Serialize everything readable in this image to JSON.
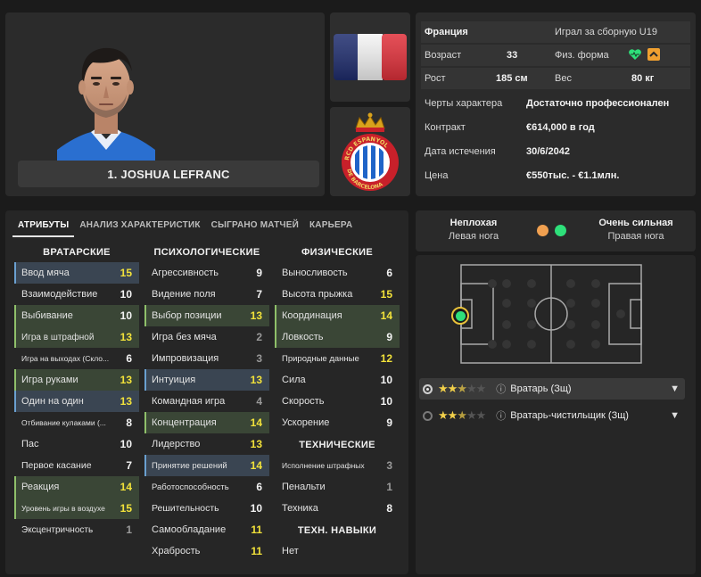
{
  "player": {
    "name": "1. JOSHUA LEFRANC"
  },
  "info": {
    "nation": "Франция",
    "intl": "Играл за сборную U19",
    "age_label": "Возраст",
    "age": "33",
    "fitness_label": "Физ. форма",
    "height_label": "Рост",
    "height": "185 см",
    "weight_label": "Вес",
    "weight": "80 кг",
    "personality_label": "Черты характера",
    "personality": "Достаточно профессионален",
    "contract_label": "Контракт",
    "contract": "€614,000 в год",
    "expiry_label": "Дата истечения",
    "expiry": "30/6/2042",
    "price_label": "Цена",
    "price": "€550тыс. - €1.1млн."
  },
  "tabs": [
    "АТРИБУТЫ",
    "АНАЛИЗ ХАРАКТЕРИСТИК",
    "СЫГРАНО МАТЧЕЙ",
    "КАРЬЕРА"
  ],
  "goalkeeping": {
    "title": "ВРАТАРСКИЕ",
    "rows": [
      {
        "label": "Ввод мяча",
        "value": "15"
      },
      {
        "label": "Взаимодействие",
        "value": "10"
      },
      {
        "label": "Выбивание",
        "value": "10"
      },
      {
        "label": "Игра в штрафной",
        "value": "13"
      },
      {
        "label": "Игра на выходах (Скло...",
        "value": "6"
      },
      {
        "label": "Игра руками",
        "value": "13"
      },
      {
        "label": "Один на один",
        "value": "13"
      },
      {
        "label": "Отбивание кулаками (...",
        "value": "8"
      },
      {
        "label": "Пас",
        "value": "10"
      },
      {
        "label": "Первое касание",
        "value": "7"
      },
      {
        "label": "Реакция",
        "value": "14"
      },
      {
        "label": "Уровень игры в воздухе",
        "value": "15"
      },
      {
        "label": "Эксцентричность",
        "value": "1"
      }
    ]
  },
  "mental": {
    "title": "ПСИХОЛОГИЧЕСКИЕ",
    "rows": [
      {
        "label": "Агрессивность",
        "value": "9"
      },
      {
        "label": "Видение поля",
        "value": "7"
      },
      {
        "label": "Выбор позиции",
        "value": "13"
      },
      {
        "label": "Игра без мяча",
        "value": "2"
      },
      {
        "label": "Импровизация",
        "value": "3"
      },
      {
        "label": "Интуиция",
        "value": "13"
      },
      {
        "label": "Командная игра",
        "value": "4"
      },
      {
        "label": "Концентрация",
        "value": "14"
      },
      {
        "label": "Лидерство",
        "value": "13"
      },
      {
        "label": "Принятие решений",
        "value": "14"
      },
      {
        "label": "Работоспособность",
        "value": "6"
      },
      {
        "label": "Решительность",
        "value": "10"
      },
      {
        "label": "Самообладание",
        "value": "11"
      },
      {
        "label": "Храбрость",
        "value": "11"
      }
    ]
  },
  "physical": {
    "title": "ФИЗИЧЕСКИЕ",
    "rows": [
      {
        "label": "Выносливость",
        "value": "6"
      },
      {
        "label": "Высота прыжка",
        "value": "15"
      },
      {
        "label": "Координация",
        "value": "14"
      },
      {
        "label": "Ловкость",
        "value": "9"
      },
      {
        "label": "Природные данные",
        "value": "12"
      },
      {
        "label": "Сила",
        "value": "10"
      },
      {
        "label": "Скорость",
        "value": "10"
      },
      {
        "label": "Ускорение",
        "value": "9"
      }
    ]
  },
  "technical": {
    "title": "ТЕХНИЧЕСКИЕ",
    "rows": [
      {
        "label": "Исполнение штрафных",
        "value": "3"
      },
      {
        "label": "Пенальти",
        "value": "1"
      },
      {
        "label": "Техника",
        "value": "8"
      }
    ]
  },
  "tech_skills": {
    "title": "ТЕХН. НАВЫКИ",
    "value": "Нет"
  },
  "feet": {
    "left_quality": "Неплохая",
    "left_label": "Левая нога",
    "right_quality": "Очень сильная",
    "right_label": "Правая нога",
    "left_color": "#f0a050",
    "right_color": "#2ee07a"
  },
  "roles": [
    {
      "name": "Вратарь (Зщ)",
      "stars": 2.5
    },
    {
      "name": "Вратарь-чистильщик (Зщ)",
      "stars": 2.5
    }
  ],
  "colors": {
    "accent_yellow": "#f2e23a",
    "fitness_green": "#2ee07a",
    "arrow_orange": "#f0a030"
  }
}
